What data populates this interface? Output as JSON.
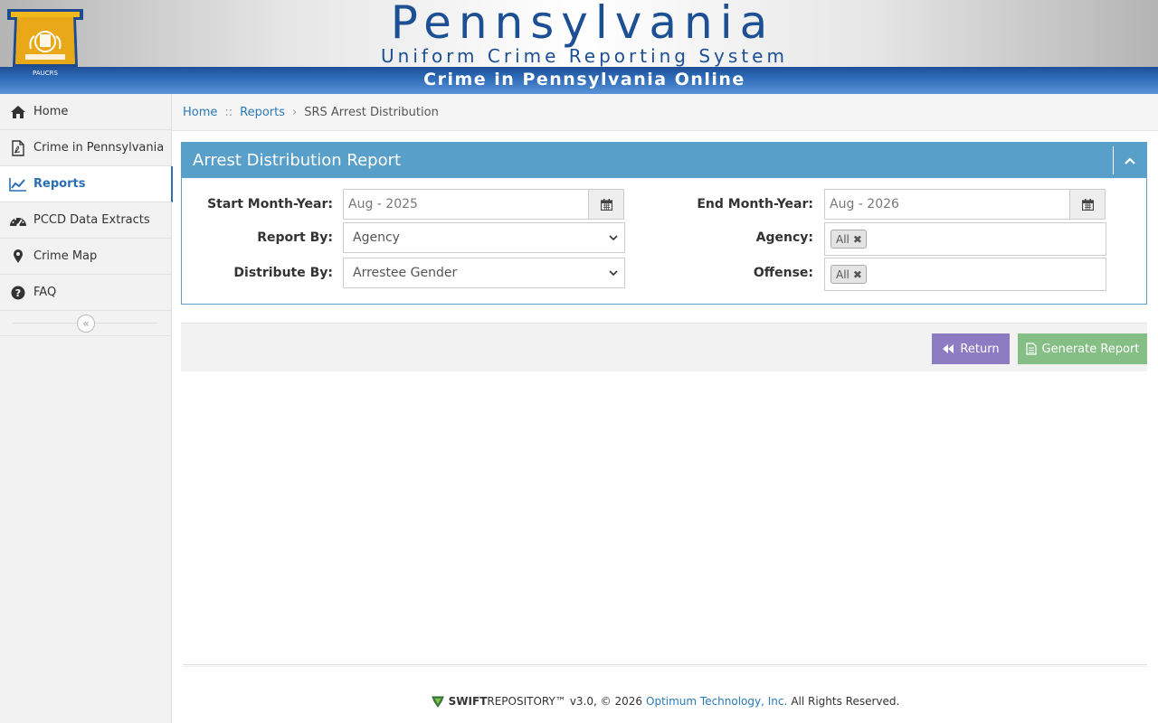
{
  "header": {
    "title": "Pennsylvania",
    "subtitle": "Uniform Crime Reporting System",
    "bar_title": "Crime in Pennsylvania Online",
    "logo_text": "PAUCRS"
  },
  "sidebar": {
    "items": [
      {
        "label": "Home",
        "icon": "home-icon"
      },
      {
        "label": "Crime in Pennsylvania",
        "icon": "pdf-icon"
      },
      {
        "label": "Reports",
        "icon": "line-chart-icon",
        "active": true
      },
      {
        "label": "PCCD Data Extracts",
        "icon": "dashboard-icon"
      },
      {
        "label": "Crime Map",
        "icon": "map-marker-icon"
      },
      {
        "label": "FAQ",
        "icon": "question-icon"
      }
    ],
    "collapse_glyph": "«"
  },
  "breadcrumb": {
    "home": "Home",
    "sep1": "::",
    "reports": "Reports",
    "sep2": "›",
    "current": "SRS Arrest Distribution"
  },
  "panel": {
    "title": "Arrest Distribution Report",
    "start_label": "Start Month-Year:",
    "start_value": "Aug - 2025",
    "end_label": "End Month-Year:",
    "end_value": "Aug - 2026",
    "report_by_label": "Report By:",
    "report_by_value": "Agency",
    "agency_label": "Agency:",
    "agency_tag": "All",
    "distribute_by_label": "Distribute By:",
    "distribute_by_value": "Arrestee Gender",
    "offense_label": "Offense:",
    "offense_tag": "All"
  },
  "actions": {
    "return_label": "Return",
    "generate_label": "Generate Report"
  },
  "footer": {
    "brand_bold": "SWIFT",
    "brand_rest": "REPOSITORY™",
    "version": "v3.0, © 2026",
    "company": "Optimum Technology, Inc.",
    "rights": "All Rights Reserved."
  },
  "colors": {
    "panel_header": "#589fc9",
    "return_button": "#8e7cc3",
    "generate_button": "#86bf86",
    "link": "#2a7ab8",
    "header_blue": "#1c4f93"
  }
}
